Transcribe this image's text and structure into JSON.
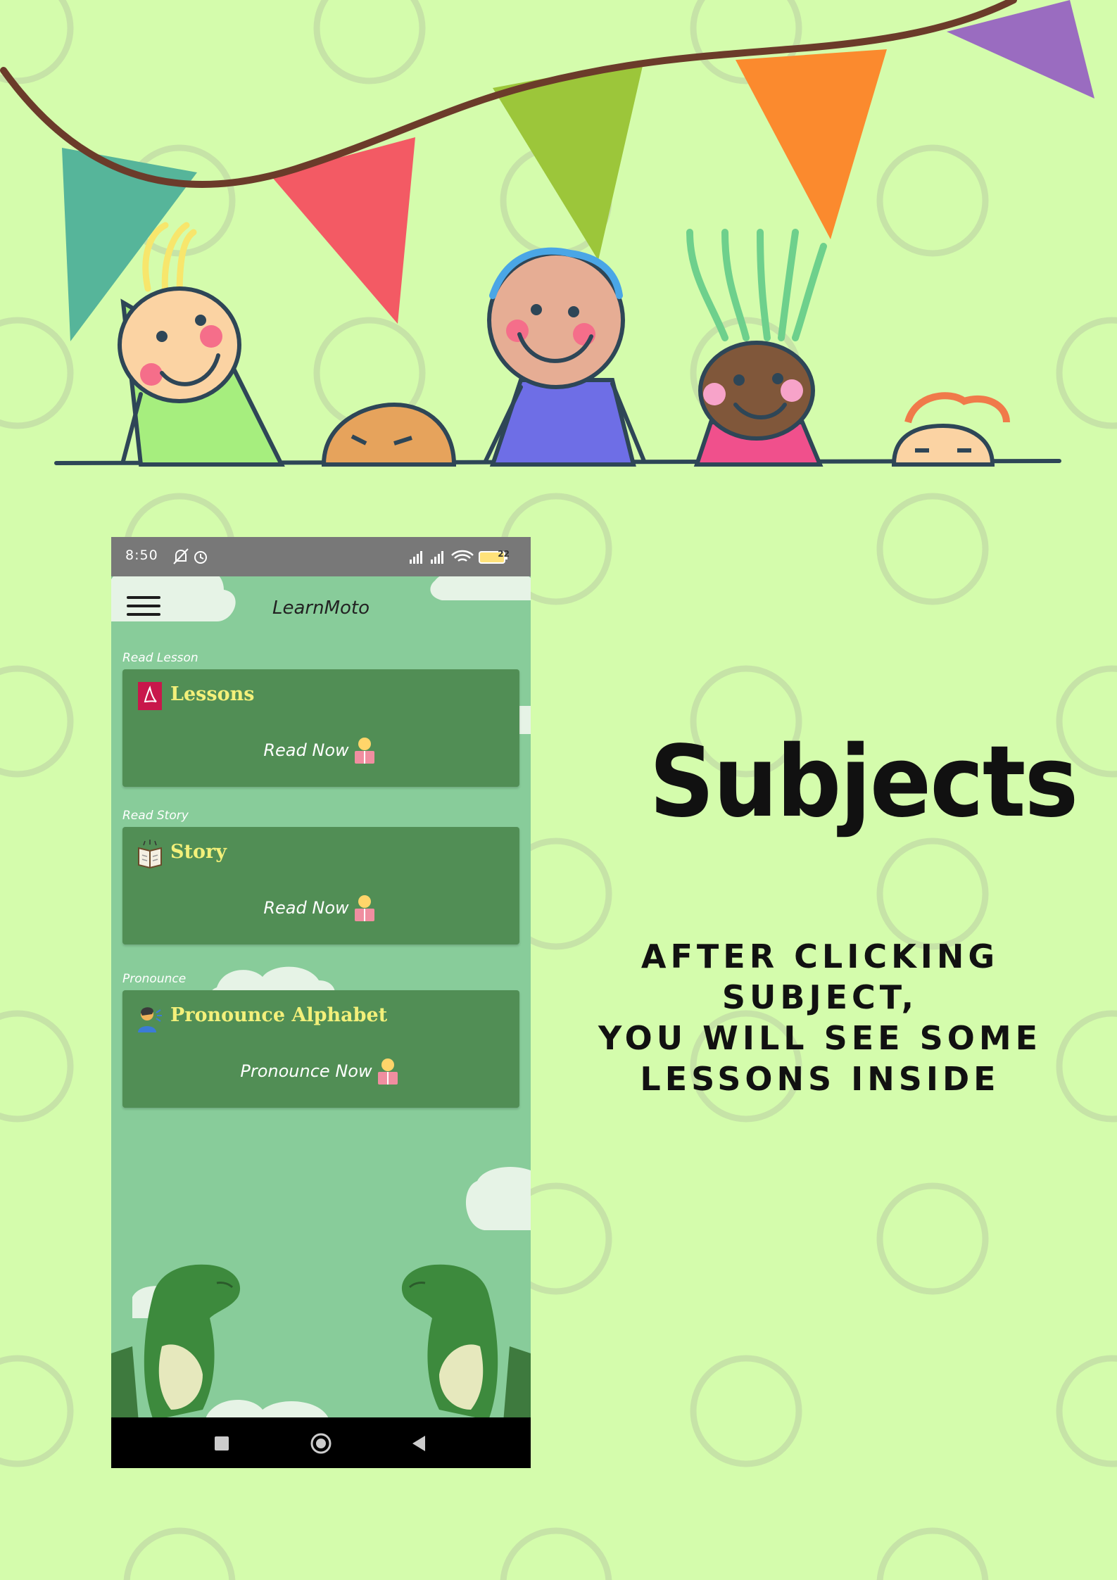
{
  "colors": {
    "page_background": "#d4fcac",
    "circle_ring": "#c6e3a7",
    "phone_background": "#88cc9a",
    "card_background": "#518e55",
    "card_title": "#f3f07a",
    "status_bar": "#787878"
  },
  "status_bar": {
    "time": "8:50",
    "battery": "22",
    "icons": [
      "mute-icon",
      "alarm-icon",
      "signal-icon",
      "signal-icon",
      "wifi-icon",
      "battery-icon"
    ]
  },
  "app_bar": {
    "title": "LearnMoto",
    "menu_icon": "hamburger-menu-icon"
  },
  "sections": [
    {
      "label": "Read Lesson",
      "card_title": "Lessons",
      "action": "Read Now",
      "icon": "pdf-icon"
    },
    {
      "label": "Read Story",
      "card_title": "Story",
      "action": "Read Now",
      "icon": "book-icon"
    },
    {
      "label": "Pronounce",
      "card_title": "Pronounce Alphabet",
      "action": "Pronounce Now",
      "icon": "speaking-person-icon"
    }
  ],
  "nav_bar": {
    "buttons": [
      "recents-square-icon",
      "home-circle-icon",
      "back-triangle-icon"
    ]
  },
  "heading": "Subjects",
  "caption": {
    "line1": "AFTER CLICKING SUBJECT,",
    "line2": "YOU WILL SEE SOME",
    "line3": "LESSONS INSIDE"
  }
}
